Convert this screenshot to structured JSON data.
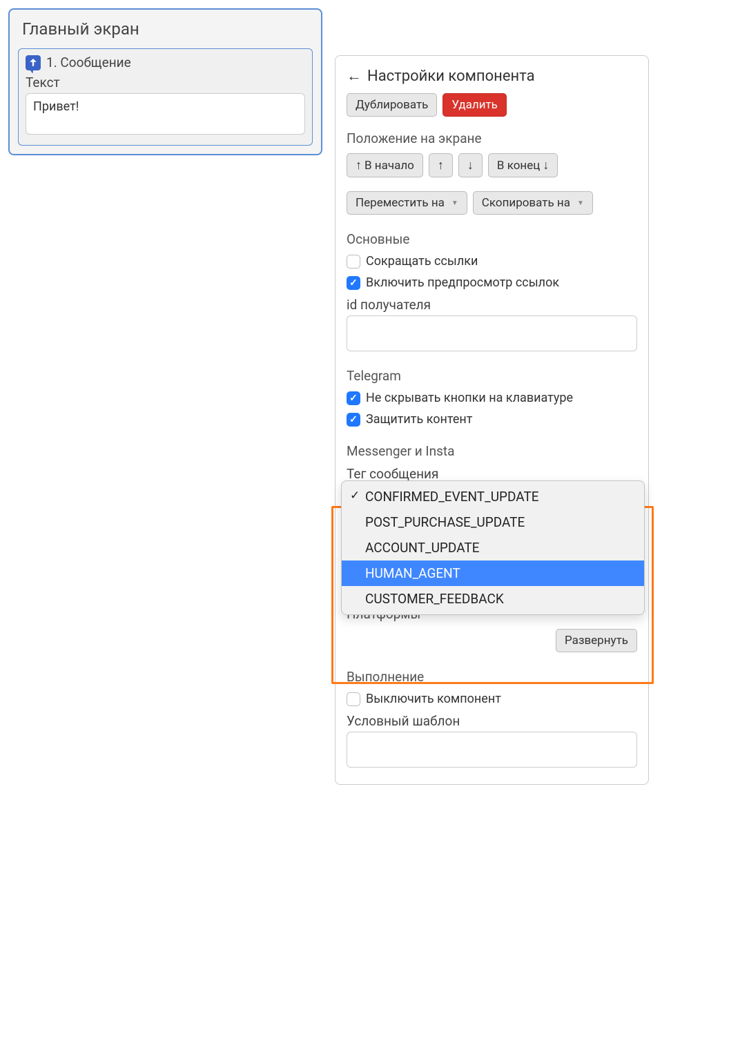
{
  "left": {
    "panel_title": "Главный экран",
    "message": {
      "header": "1. Сообщение",
      "text_label": "Текст",
      "text_value": "Привет!"
    }
  },
  "right": {
    "header": "Настройки компонента",
    "duplicate_label": "Дублировать",
    "delete_label": "Удалить",
    "position": {
      "title": "Положение на экране",
      "to_start": "В начало",
      "to_end": "В конец",
      "move_to": "Переместить на",
      "copy_to": "Скопировать на"
    },
    "main": {
      "title": "Основные",
      "shorten_links_label": "Сокращать ссылки",
      "shorten_links_checked": false,
      "preview_links_label": "Включить предпросмотр ссылок",
      "preview_links_checked": true,
      "recipient_id_label": "id получателя",
      "recipient_id_value": ""
    },
    "telegram": {
      "title": "Telegram",
      "keep_keyboard_label": "Не скрывать кнопки на клавиатуре",
      "keep_keyboard_checked": true,
      "protect_content_label": "Защитить контент",
      "protect_content_checked": true
    },
    "messenger": {
      "title": "Messenger и Insta",
      "tag_label": "Тег сообщения",
      "dropdown": {
        "options": [
          "CONFIRMED_EVENT_UPDATE",
          "POST_PURCHASE_UPDATE",
          "ACCOUNT_UPDATE",
          "HUMAN_AGENT",
          "CUSTOMER_FEEDBACK"
        ],
        "selected_index": 0,
        "hover_index": 3
      }
    },
    "platforms": {
      "title": "Платформы",
      "expand_label": "Развернуть"
    },
    "execution": {
      "title": "Выполнение",
      "disable_label": "Выключить компонент",
      "disable_checked": false,
      "template_label": "Условный шаблон",
      "template_value": ""
    }
  }
}
